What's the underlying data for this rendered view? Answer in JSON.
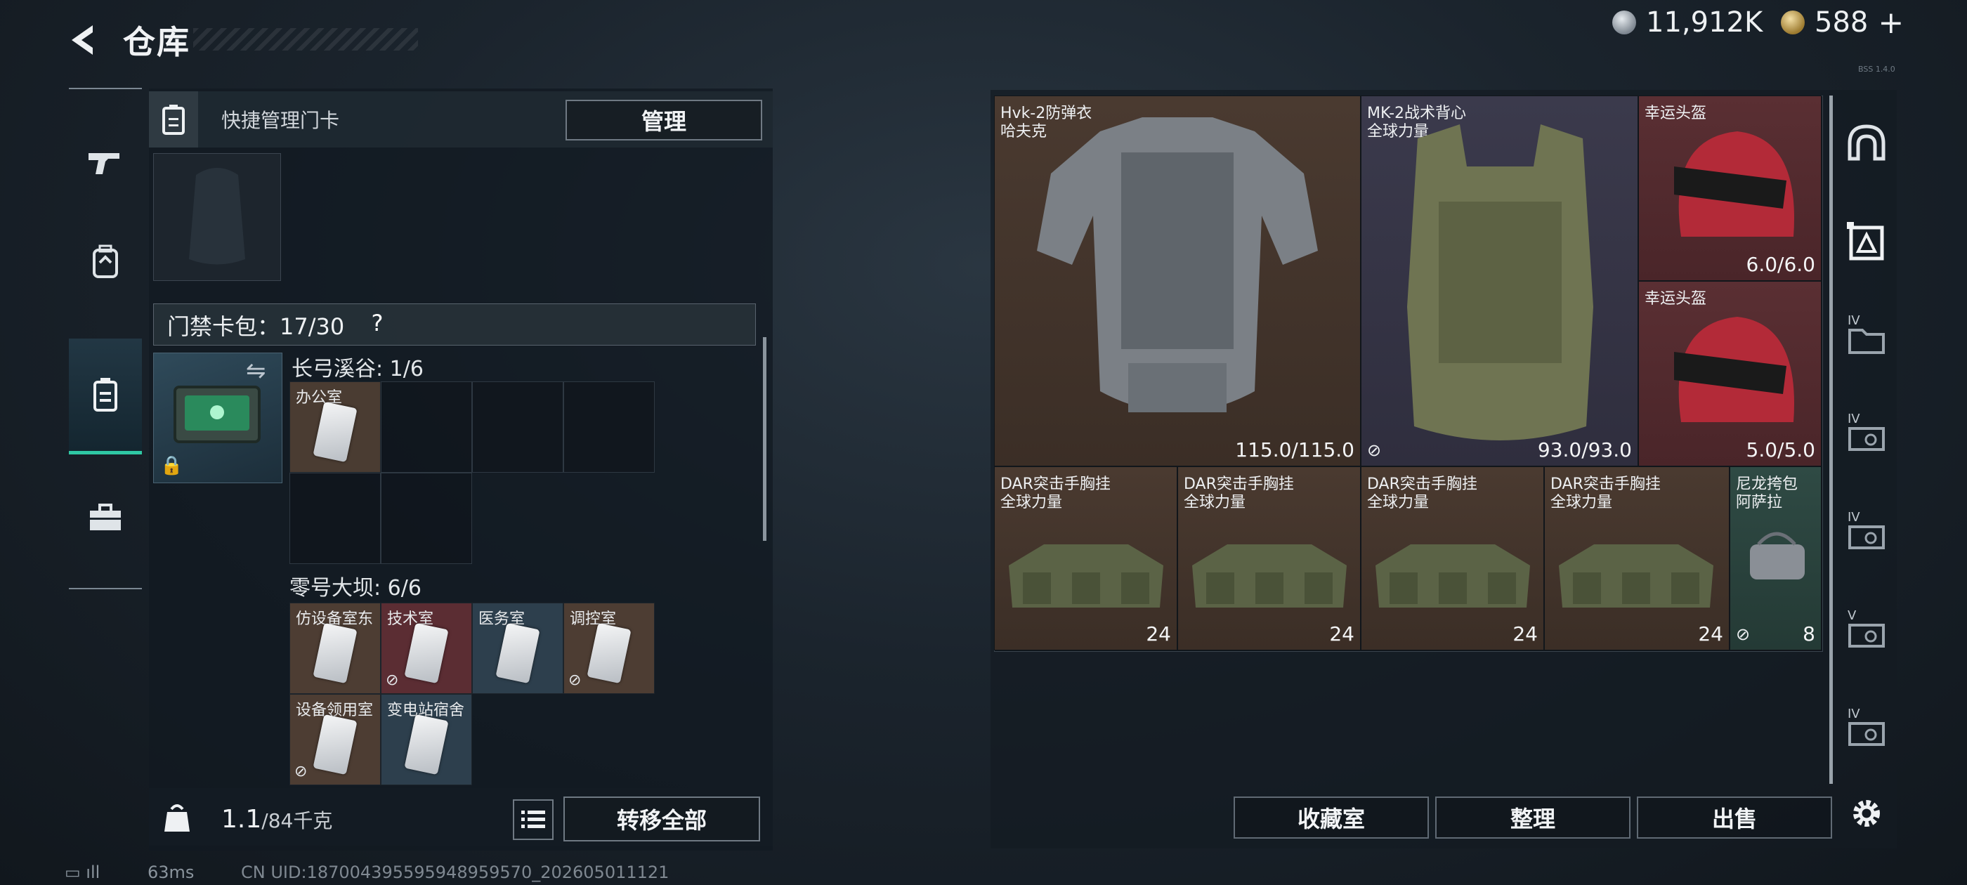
{
  "header": {
    "title": "仓库",
    "back_icon": "back-arrow-icon"
  },
  "currency": [
    {
      "icon": "silver-coin-icon",
      "value": "11,912K"
    },
    {
      "icon": "gold-coin-icon",
      "value": "588",
      "add": "+"
    }
  ],
  "version": "BSS 1.4.0",
  "left_rail": [
    {
      "icon": "pistol-icon"
    },
    {
      "icon": "backpack-icon"
    },
    {
      "icon": "keycard-pack-icon",
      "active": true
    },
    {
      "icon": "briefcase-icon"
    }
  ],
  "quick": {
    "label": "快捷管理门卡",
    "button": "管理"
  },
  "keypack": {
    "label": "门禁卡包：17/30",
    "help": "?"
  },
  "sections": [
    {
      "title": "长弓溪谷: 1/6",
      "cards": [
        {
          "name": "办公室",
          "color": "#4a3c32",
          "nocarry": false
        }
      ]
    },
    {
      "title": "零号大坝: 6/6",
      "cards": [
        {
          "name": "仿设备室东",
          "color": "#4d3d33",
          "nocarry": false
        },
        {
          "name": "技术室",
          "color": "#5b2d33",
          "nocarry": true
        },
        {
          "name": "医务室",
          "color": "#2d3f4d",
          "nocarry": false
        },
        {
          "name": "调控室",
          "color": "#4d3d33",
          "nocarry": true
        },
        {
          "name": "设备领用室",
          "color": "#4d3d33",
          "nocarry": true
        },
        {
          "name": "变电站宿舍",
          "color": "#2d3f4d",
          "nocarry": false
        }
      ]
    }
  ],
  "bottom_left": {
    "weight": "1.1",
    "weight_max": "/84千克",
    "transfer": "转移全部"
  },
  "status": {
    "ping": "63ms",
    "uid": "CN UID:18700439559594895957​0_202605011121"
  },
  "items": [
    {
      "name": "Hvk-2防弹衣",
      "sub": "哈夫克",
      "value": "115.0/115.0",
      "tier": "brown",
      "nocarry": false
    },
    {
      "name": "MK-2战术背心",
      "sub": "全球力量",
      "value": "93.0/93.0",
      "tier": "purple",
      "nocarry": true
    },
    {
      "name": "幸运头盔",
      "sub": "",
      "value": "6.0/6.0",
      "tier": "red",
      "nocarry": false
    },
    {
      "name": "幸运头盔",
      "sub": "",
      "value": "5.0/5.0",
      "tier": "red",
      "nocarry": false
    },
    {
      "name": "DAR突击手胸挂",
      "sub": "全球力量",
      "value": "24",
      "tier": "brown",
      "nocarry": false
    },
    {
      "name": "DAR突击手胸挂",
      "sub": "全球力量",
      "value": "24",
      "tier": "brown",
      "nocarry": false
    },
    {
      "name": "DAR突击手胸挂",
      "sub": "全球力量",
      "value": "24",
      "tier": "brown",
      "nocarry": false
    },
    {
      "name": "DAR突击手胸挂",
      "sub": "全球力量",
      "value": "24",
      "tier": "brown",
      "nocarry": false
    },
    {
      "name": "尼龙挎包",
      "sub": "阿萨拉",
      "value": "8",
      "tier": "green",
      "nocarry": true
    }
  ],
  "right_rail": [
    {
      "icon": "helmet-icon",
      "tag": ""
    },
    {
      "icon": "armor-icon",
      "tag": "",
      "active": true
    },
    {
      "icon": "folder-tier-iv-icon",
      "tag": "IV"
    },
    {
      "icon": "ticket-tier-iv-icon",
      "tag": "IV"
    },
    {
      "icon": "ticket-tier-iv-icon",
      "tag": "IV"
    },
    {
      "icon": "ticket-tier-v-icon",
      "tag": "V"
    },
    {
      "icon": "ticket-tier-iv-icon",
      "tag": "IV"
    }
  ],
  "right_buttons": {
    "collection": "收藏室",
    "sort": "整理",
    "sell": "出售"
  },
  "colors": {
    "accent": "#2fc8a4",
    "brown": "#4a3a30",
    "purple": "#3b3a4c",
    "red": "#5a2f33",
    "green": "#2f4a44"
  }
}
